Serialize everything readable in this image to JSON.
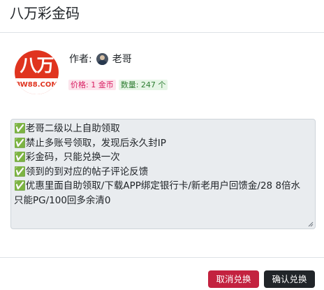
{
  "modal": {
    "title": "八万彩金码"
  },
  "logo": {
    "chars": "八万",
    "domain": "BW88.COM"
  },
  "author": {
    "label": "作者:",
    "name": "老哥"
  },
  "badges": {
    "price": "价格: 1 金币",
    "quantity": "数量: 247 个"
  },
  "description": {
    "value": "✅老哥二级以上自助领取\n✅禁止多账号领取，发现后永久封IP\n✅彩金码，只能兑换一次\n✅领到的到对应的帖子评论反馈\n✅优惠里面自助领取/下载APP绑定银行卡/新老用户回馈金/28 8倍水 只能PG/100回多余清0"
  },
  "footer": {
    "cancel_label": "取消兑换",
    "confirm_label": "确认兑换"
  },
  "colors": {
    "cancel_button": "#c3223f",
    "confirm_button": "#212529",
    "logo_red": "#e0341f",
    "price_badge_text": "#d81b60",
    "quantity_badge_text": "#2e7d32"
  }
}
